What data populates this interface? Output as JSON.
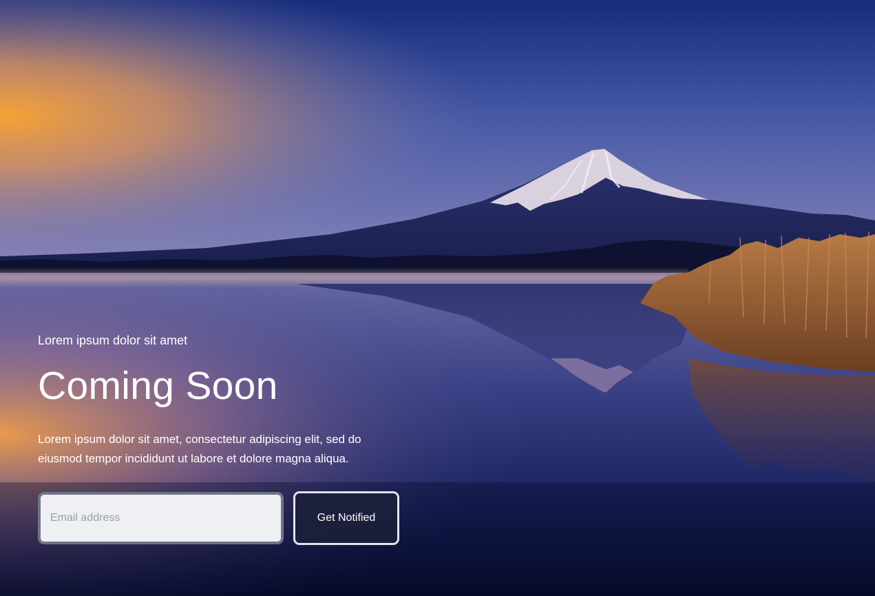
{
  "hero": {
    "eyebrow": "Lorem ipsum dolor sit amet",
    "title": "Coming Soon",
    "description": "Lorem ipsum dolor sit amet, consectetur adipiscing elit, sed do eiusmod tempor incididunt ut labore et dolore magna aliqua.",
    "background_image": "mountain-lake-sunrise-photo"
  },
  "form": {
    "email_placeholder": "Email address",
    "email_value": "",
    "submit_label": "Get Notified"
  },
  "colors": {
    "sky_top": "#142a7a",
    "sunrise_glow": "#f2a23a",
    "water_deep": "#0a1236",
    "button_bg": "#1c203a",
    "input_bg": "#eef0f4"
  }
}
